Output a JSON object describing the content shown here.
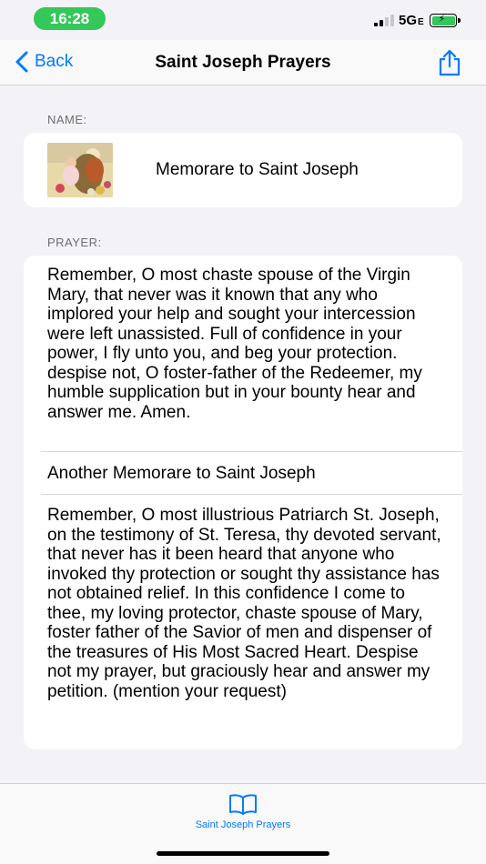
{
  "status_bar": {
    "time": "16:28",
    "network": "5G",
    "network_suffix": "E",
    "accent": "#34c759"
  },
  "nav": {
    "back_label": "Back",
    "title": "Saint Joseph Prayers",
    "share_icon": "share-icon",
    "back_icon": "chevron-left-icon",
    "tint": "#007aff"
  },
  "name_section": {
    "label": "NAME:",
    "prayer_name": "Memorare to Saint Joseph"
  },
  "prayer_section": {
    "label": "PRAYER:",
    "first_prayer": "Remember, O most chaste spouse of the Virgin Mary, that never was it known that any who implored your help and sought your intercession were left unassisted. Full of confidence in your power, I fly unto you, and beg your protection. despise not, O foster-father of the Redeemer, my humble supplication but in your bounty hear and answer me. Amen.",
    "second_title": "Another Memorare to Saint Joseph",
    "second_prayer": "Remember, O most illustrious Patriarch St. Joseph, on the testimony of St. Teresa, thy devoted servant, that never has it been heard that anyone who invoked thy protection or sought thy assistance has not obtained relief. In this confidence I come to thee, my loving protector, chaste spouse of Mary, foster father of the Savior of men and dispenser of the treasures of His Most Sacred Heart. Despise not my prayer, but graciously hear and answer my petition. (mention your request)"
  },
  "tab_bar": {
    "tab_label": "Saint Joseph Prayers",
    "tab_icon": "book-icon"
  }
}
